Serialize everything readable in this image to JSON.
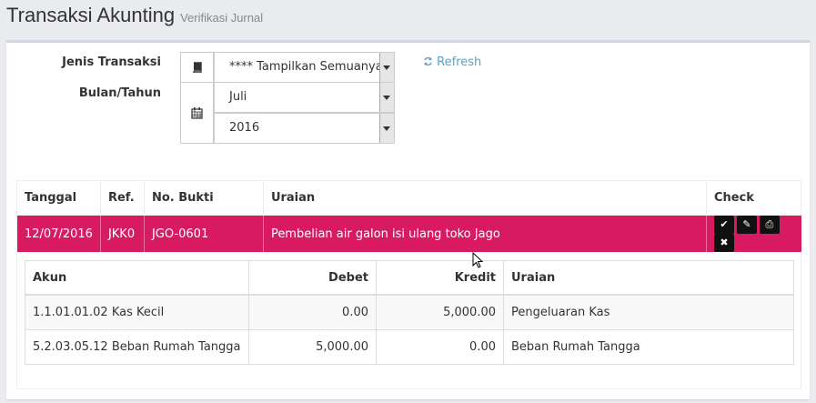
{
  "header": {
    "title": "Transaksi Akunting",
    "subtitle": "Verifikasi Jurnal"
  },
  "filters": {
    "jenis_label": "Jenis Transaksi",
    "jenis_value": "**** Tampilkan Semuanya",
    "bulan_label": "Bulan/Tahun",
    "bulan_value": "Juli",
    "tahun_value": "2016",
    "refresh_label": "Refresh"
  },
  "icons": {
    "book": "book-icon",
    "calendar": "calendar-icon",
    "refresh": "refresh-icon",
    "check": "check-icon",
    "edit": "pencil-icon",
    "print": "print-icon",
    "delete": "close-icon"
  },
  "colors": {
    "accent": "#d81b60",
    "link": "#5da1c7"
  },
  "table": {
    "headers": [
      "Tanggal",
      "Ref.",
      "No. Bukti",
      "Uraian",
      "Check"
    ],
    "row": {
      "tanggal": "12/07/2016",
      "ref": "JKK0",
      "no_bukti": "JGO-0601",
      "uraian": "Pembelian air galon isi ulang toko Jago"
    }
  },
  "detail": {
    "headers": [
      "Akun",
      "Debet",
      "Kredit",
      "Uraian"
    ],
    "rows": [
      {
        "akun": "1.1.01.01.02 Kas Kecil",
        "debet": "0.00",
        "kredit": "5,000.00",
        "uraian": "Pengeluaran Kas"
      },
      {
        "akun": "5.2.03.05.12 Beban Rumah Tangga",
        "debet": "5,000.00",
        "kredit": "0.00",
        "uraian": "Beban Rumah Tangga"
      }
    ]
  }
}
